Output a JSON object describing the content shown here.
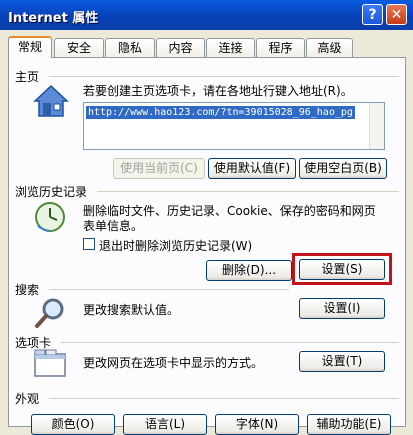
{
  "window": {
    "title": "Internet 属性",
    "help_label": "?",
    "close_label": "✕"
  },
  "tabs": [
    "常规",
    "安全",
    "隐私",
    "内容",
    "连接",
    "程序",
    "高级"
  ],
  "home": {
    "title": "主页",
    "description": "若要创建主页选项卡，请在各地址行键入地址(R)。",
    "url": "http://www.hao123.com/?tn=39015028_96_hao_pg",
    "buttons": {
      "current": "使用当前页(C)",
      "default": "使用默认值(F)",
      "blank": "使用空白页(B)"
    }
  },
  "history": {
    "title": "浏览历史记录",
    "description_line1": "删除临时文件、历史记录、Cookie、保存的密码和网页",
    "description_line2": "表单信息。",
    "checkbox_label": "退出时删除浏览历史记录(W)",
    "delete_button": "删除(D)...",
    "settings_button": "设置(S)"
  },
  "search": {
    "title": "搜索",
    "description": "更改搜索默认值。",
    "settings_button": "设置(I)"
  },
  "tabs_section": {
    "title": "选项卡",
    "description": "更改网页在选项卡中显示的方式。",
    "settings_button": "设置(T)"
  },
  "appearance": {
    "title": "外观",
    "buttons": [
      "颜色(O)",
      "语言(L)",
      "字体(N)",
      "辅助功能(E)"
    ]
  },
  "icons": [
    "house-icon",
    "history-clock-icon",
    "magnifier-icon",
    "tabs-icon"
  ],
  "colors": {
    "titlebar": "#0842B8",
    "highlight": "#C0141A",
    "dialog_bg": "#ECE9D8"
  }
}
